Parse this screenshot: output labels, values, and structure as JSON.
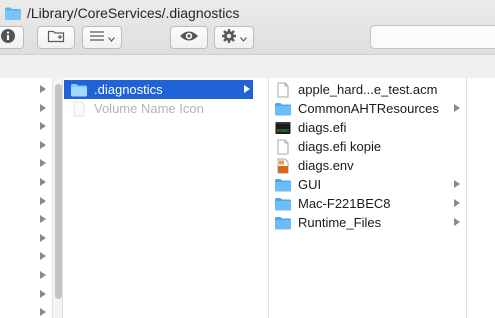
{
  "window": {
    "title": "/Library/CoreServices/.diagnostics"
  },
  "toolbar": {
    "buttons": [
      "info-icon",
      "new-folder-icon",
      "view-options-icon",
      "quick-look-eye-icon",
      "action-gear-icon"
    ],
    "search": {
      "placeholder": ""
    }
  },
  "columns": {
    "parent_rows": 13,
    "selected_folder": {
      "name": ".diagnostics",
      "icon": "folder-icon"
    },
    "ghost_item": {
      "name": "Volume Name Icon",
      "icon": "file-icon"
    },
    "items": [
      {
        "name": "apple_hard...e_test.acm",
        "icon": "document-icon",
        "is_folder": false
      },
      {
        "name": "CommonAHTResources",
        "icon": "folder-icon",
        "is_folder": true
      },
      {
        "name": "diags.efi",
        "icon": "executable-icon",
        "is_folder": false
      },
      {
        "name": "diags.efi kopie",
        "icon": "document-icon",
        "is_folder": false
      },
      {
        "name": "diags.env",
        "icon": "env-file-icon",
        "is_folder": false
      },
      {
        "name": "GUI",
        "icon": "folder-icon",
        "is_folder": true
      },
      {
        "name": "Mac-F221BEC8",
        "icon": "folder-icon",
        "is_folder": true
      },
      {
        "name": "Runtime_Files",
        "icon": "folder-icon",
        "is_folder": true
      }
    ]
  },
  "colors": {
    "selection": "#1f63d6",
    "folder": "#5ab2f3",
    "text": "#1a1a1a"
  }
}
